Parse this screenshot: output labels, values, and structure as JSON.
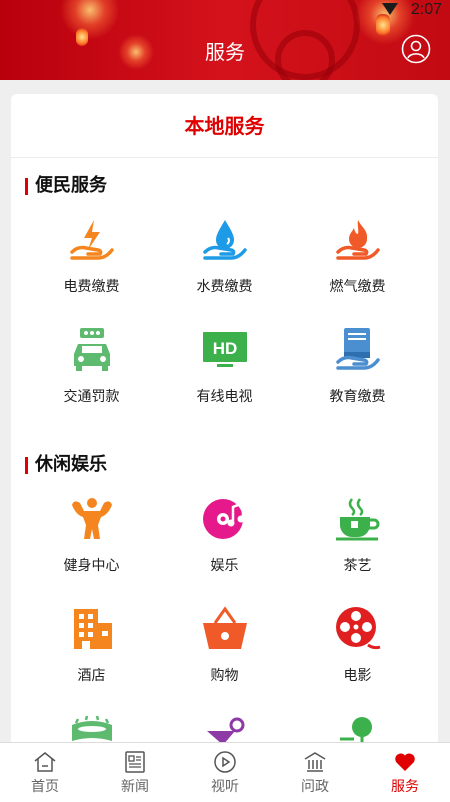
{
  "status_bar": {
    "time": "2:07"
  },
  "header": {
    "title": "服务"
  },
  "card": {
    "title": "本地服务",
    "sections": [
      {
        "title": "便民服务",
        "items": [
          {
            "label": "电费缴费",
            "icon": "electricity-bill-icon",
            "color": "#f5861f"
          },
          {
            "label": "水费缴费",
            "icon": "water-bill-icon",
            "color": "#1e9be6"
          },
          {
            "label": "燃气缴费",
            "icon": "gas-bill-icon",
            "color": "#f05a28"
          },
          {
            "label": "交通罚款",
            "icon": "traffic-fine-icon",
            "color": "#5dba6e"
          },
          {
            "label": "有线电视",
            "icon": "cable-tv-icon",
            "color": "#3cb04a",
            "badge": "HD"
          },
          {
            "label": "教育缴费",
            "icon": "education-fee-icon",
            "color": "#4b8fd1"
          }
        ]
      },
      {
        "title": "休闲娱乐",
        "items": [
          {
            "label": "健身中心",
            "icon": "fitness-icon",
            "color": "#f5861f"
          },
          {
            "label": "娱乐",
            "icon": "music-disc-icon",
            "color": "#e6198c"
          },
          {
            "label": "茶艺",
            "icon": "tea-cup-icon",
            "color": "#3cb04a"
          },
          {
            "label": "酒店",
            "icon": "hotel-icon",
            "color": "#f5861f"
          },
          {
            "label": "购物",
            "icon": "shopping-basket-icon",
            "color": "#f05a28"
          },
          {
            "label": "电影",
            "icon": "film-reel-icon",
            "color": "#e02020"
          }
        ]
      }
    ]
  },
  "bottom_nav": [
    {
      "label": "首页",
      "icon": "home-icon",
      "active": false
    },
    {
      "label": "新闻",
      "icon": "news-icon",
      "active": false
    },
    {
      "label": "视听",
      "icon": "play-icon",
      "active": false
    },
    {
      "label": "问政",
      "icon": "government-icon",
      "active": false
    },
    {
      "label": "服务",
      "icon": "heart-icon",
      "active": true
    }
  ],
  "colors": {
    "brand_red": "#e00000",
    "header_red": "#c8101a"
  }
}
